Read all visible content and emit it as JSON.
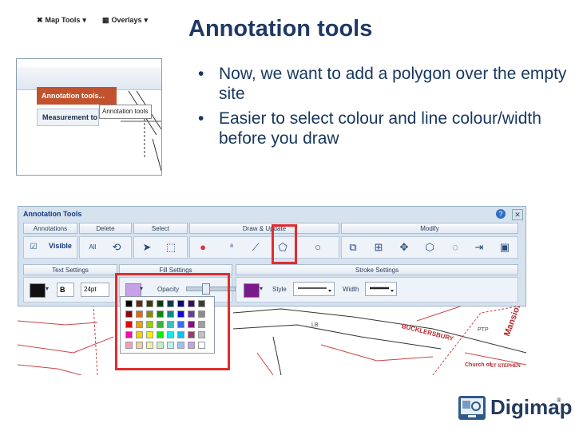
{
  "slide": {
    "title": "Annotation tools",
    "bullets": [
      "Now, we want to add a polygon over the empty site",
      "Easier to select colour and line colour/width before you draw"
    ]
  },
  "menu_screenshot": {
    "map_tools_label": "Map Tools",
    "overlays_label": "Overlays",
    "annotation_tools_item": "Annotation tools...",
    "measurement_tools_item": "Measurement to",
    "tooltip": "Annotation tools"
  },
  "toolbar": {
    "title": "Annotation Tools",
    "groups": [
      "Annotations",
      "Delete",
      "Select",
      "Draw & Update",
      "Modify"
    ],
    "visible_label": "Visible",
    "all_label": "All",
    "settings_groups": [
      "Text Settings",
      "Fill Settings",
      "Stroke Settings"
    ],
    "bold_label": "B",
    "font_size": "24pt",
    "opacity_label": "Opacity",
    "style_label": "Style",
    "width_label": "Width"
  },
  "map_labels": [
    "BUCKLERSBURY",
    "Mansion",
    "LB",
    "PTP",
    "Church of",
    "ST STEPHEN"
  ],
  "colors": {
    "accent_red": "#e42b2b",
    "title_blue": "#1f3864",
    "fill_swatch": "#c8a0e8",
    "stroke_swatch": "#7a1a8a",
    "text_swatch": "#111111"
  },
  "palette_colors": [
    [
      "#000000",
      "#6b2b12",
      "#3c3c00",
      "#0b3d0b",
      "#0a3c4c",
      "#0a0a7a",
      "#3c0a6b",
      "#3c3c3c"
    ],
    [
      "#8a0a0a",
      "#e06a0a",
      "#8a8a0a",
      "#0a8a0a",
      "#0a8a8a",
      "#0a0ae0",
      "#6b3c9a",
      "#8a8a8a"
    ],
    [
      "#e00a0a",
      "#f0a00a",
      "#9ad00a",
      "#3cb03c",
      "#3cc0c0",
      "#3c6bf0",
      "#8a0a8a",
      "#a0a0a0"
    ],
    [
      "#f00ab0",
      "#f0d00a",
      "#f0f00a",
      "#0af00a",
      "#0af0f0",
      "#0ac0f0",
      "#9a3c6b",
      "#c0c0c0"
    ],
    [
      "#f0a0c0",
      "#f0d0a0",
      "#f0f0a0",
      "#c0f0c0",
      "#c0f0f0",
      "#a0c0f0",
      "#c8a0e8",
      "#ffffff"
    ]
  ],
  "logo": {
    "name": "Digimap",
    "reg": "®"
  }
}
